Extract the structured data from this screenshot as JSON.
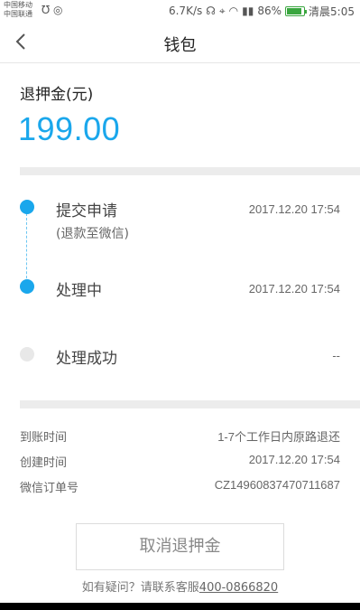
{
  "statusbar": {
    "carrier_line1": "中国移动",
    "carrier_line2": "中国联通",
    "speed": "6.7K/s",
    "battery_percent": "86%",
    "time": "清晨5:05"
  },
  "nav": {
    "title": "钱包"
  },
  "refund": {
    "label": "退押金(元)",
    "amount": "199.00"
  },
  "timeline": [
    {
      "title": "提交申请",
      "subtitle": "(退款至微信)",
      "time": "2017.12.20 17:54",
      "state": "active"
    },
    {
      "title": "处理中",
      "time": "2017.12.20 17:54",
      "state": "active"
    },
    {
      "title": "处理成功",
      "time": "--",
      "state": "inactive"
    }
  ],
  "info": [
    {
      "label": "到账时间",
      "value": "1-7个工作日内原路退还"
    },
    {
      "label": "创建时间",
      "value": "2017.12.20 17:54"
    },
    {
      "label": "微信订单号",
      "value": "CZ14960837470711687"
    }
  ],
  "cancel_button": "取消退押金",
  "help": {
    "text": "如有疑问？请联系客服",
    "phone": "400-0866820"
  },
  "colors": {
    "accent": "#1aa7ec",
    "inactive_dot": "#e8e8e8"
  }
}
